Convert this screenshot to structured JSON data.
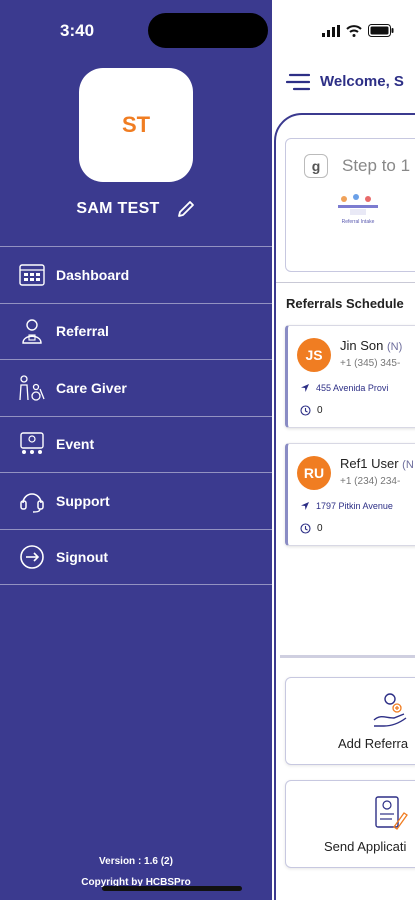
{
  "status_bar": {
    "time": "3:40"
  },
  "drawer": {
    "user_initials": "ST",
    "user_name": "SAM TEST",
    "menu": [
      {
        "label": "Dashboard",
        "icon": "dashboard-icon"
      },
      {
        "label": "Referral",
        "icon": "referral-icon"
      },
      {
        "label": "Care Giver",
        "icon": "caregiver-icon"
      },
      {
        "label": "Event",
        "icon": "event-icon"
      },
      {
        "label": "Support",
        "icon": "headset-icon"
      },
      {
        "label": "Signout",
        "icon": "signout-icon"
      }
    ],
    "version": "Version : 1.6 (2)",
    "copyright": "Copyright by HCBSPro"
  },
  "main": {
    "welcome": "Welcome, S",
    "steps_card": {
      "badge": "g",
      "title": "Step to 1",
      "step_caption": "Referral Intake"
    },
    "referrals_heading": "Referrals Schedule",
    "referrals": [
      {
        "initials": "JS",
        "name": "Jin Son",
        "tag": "(N)",
        "phone": "+1 (345) 345-",
        "address": "455 Avenida Provi",
        "count": "0"
      },
      {
        "initials": "RU",
        "name": "Ref1 User",
        "tag": "(N",
        "phone": "+1 (234) 234-",
        "address": "1797 Pitkin Avenue",
        "count": "0"
      }
    ],
    "actions": [
      {
        "label": "Add Referra",
        "icon": "add-referral-icon"
      },
      {
        "label": "Send Applicati",
        "icon": "application-icon"
      }
    ]
  },
  "colors": {
    "drawer_bg": "#3b3a8f",
    "accent_orange": "#f07d22",
    "text_navy": "#2d2f86"
  }
}
